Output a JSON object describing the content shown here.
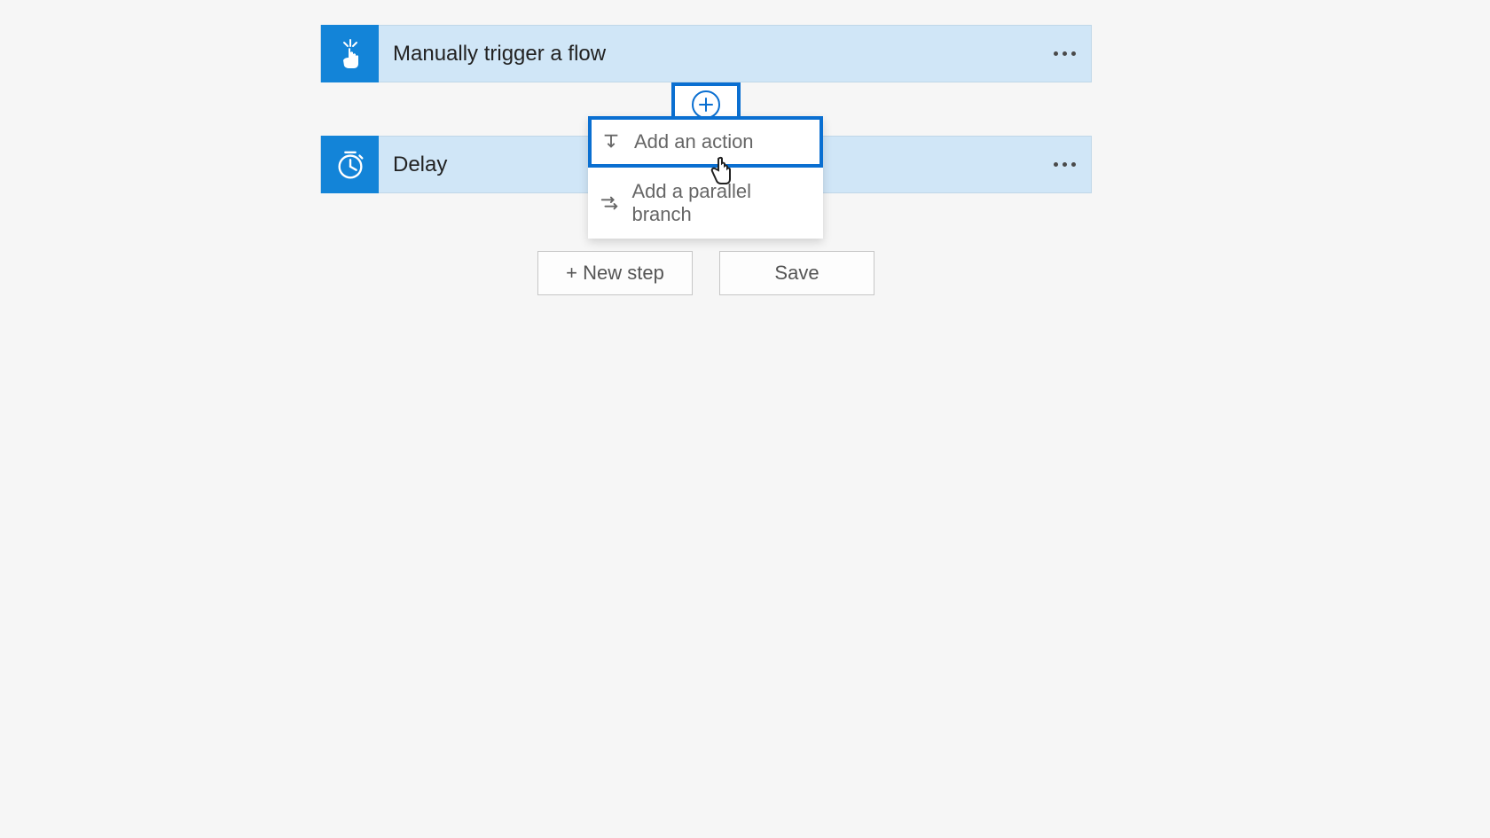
{
  "cards": [
    {
      "title": "Manually trigger a flow"
    },
    {
      "title": "Delay"
    }
  ],
  "connector": {
    "plus_label": "+",
    "menu": {
      "add_action": "Add an action",
      "add_parallel": "Add a parallel branch"
    }
  },
  "buttons": {
    "new_step": "+ New step",
    "save": "Save"
  }
}
